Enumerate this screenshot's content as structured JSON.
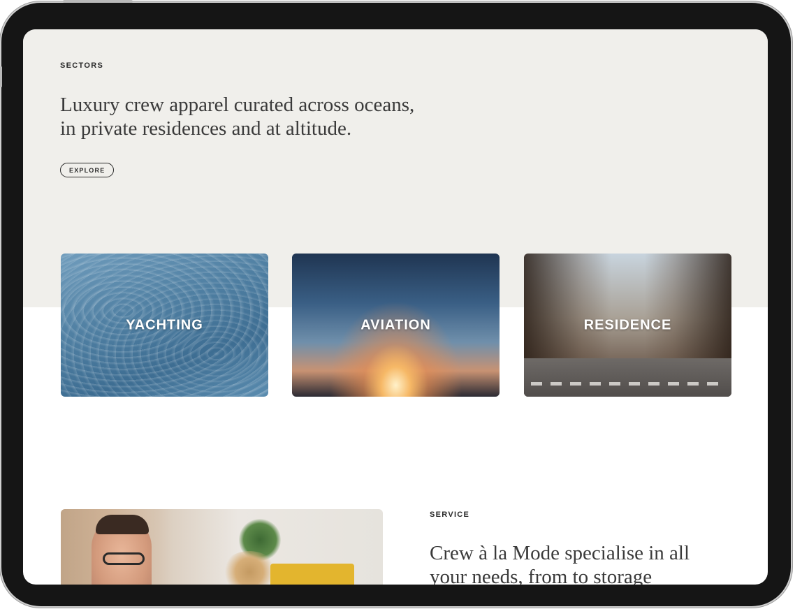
{
  "sectors": {
    "eyebrow": "SECTORS",
    "headline_line1": "Luxury crew apparel curated across oceans,",
    "headline_line2": "in private residences and at altitude.",
    "explore_label": "EXPLORE"
  },
  "cards": [
    {
      "label": "YACHTING"
    },
    {
      "label": "AVIATION"
    },
    {
      "label": "RESIDENCE"
    }
  ],
  "service": {
    "eyebrow": "SERVICE",
    "headline_line1": "Crew à la Mode specialise in all",
    "headline_line2": "your needs, from to storage"
  },
  "colors": {
    "hero_background": "#f0efeb",
    "text_dark": "#2a2a2a",
    "device_bezel": "#151515"
  }
}
